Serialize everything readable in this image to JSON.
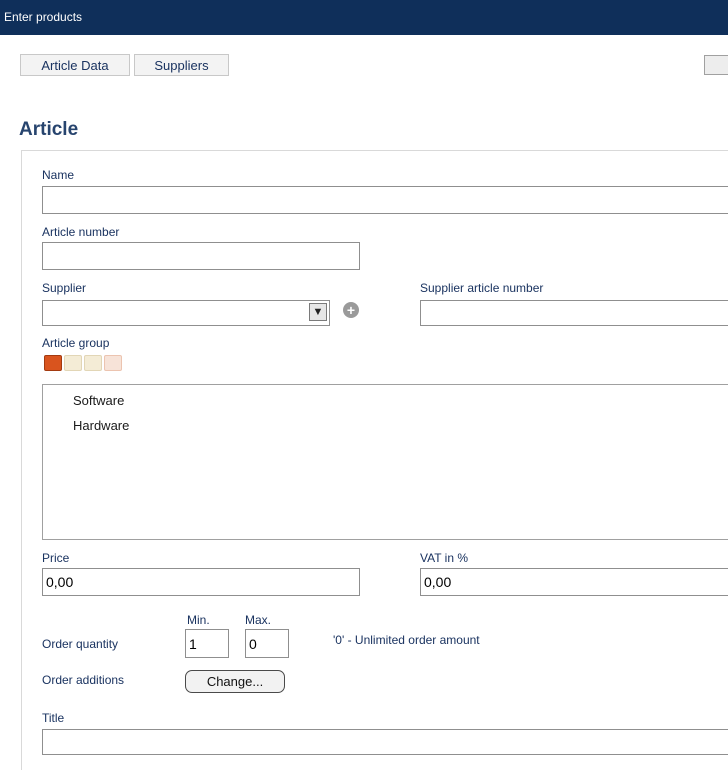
{
  "window": {
    "title": "Enter products"
  },
  "tabs": [
    {
      "label": "Article Data"
    },
    {
      "label": "Suppliers"
    }
  ],
  "section": {
    "title": "Article"
  },
  "form": {
    "name_label": "Name",
    "name_value": "",
    "article_number_label": "Article number",
    "article_number_value": "",
    "supplier_label": "Supplier",
    "supplier_value": "",
    "supplier_article_number_label": "Supplier article number",
    "supplier_article_number_value": "",
    "article_group_label": "Article group",
    "article_groups": [
      "Software",
      "Hardware"
    ],
    "price_label": "Price",
    "price_value": "0,00",
    "vat_label": "VAT in %",
    "vat_value": "0,00",
    "order_quantity_label": "Order quantity",
    "min_label": "Min.",
    "max_label": "Max.",
    "min_value": "1",
    "max_value": "0",
    "order_hint": "'0' - Unlimited order amount",
    "order_additions_label": "Order additions",
    "change_button_label": "Change...",
    "title_label": "Title",
    "title_value": ""
  },
  "icons": {
    "help": "help-icon",
    "add_supplier": "plus-circle-icon",
    "group_toolbar": [
      "folder-open-icon",
      "folder-new-icon",
      "folder-edit-icon",
      "folder-delete-icon"
    ]
  },
  "colors": {
    "titlebar": "#0f2f5a",
    "label": "#1a3360",
    "heading": "#27446e"
  }
}
